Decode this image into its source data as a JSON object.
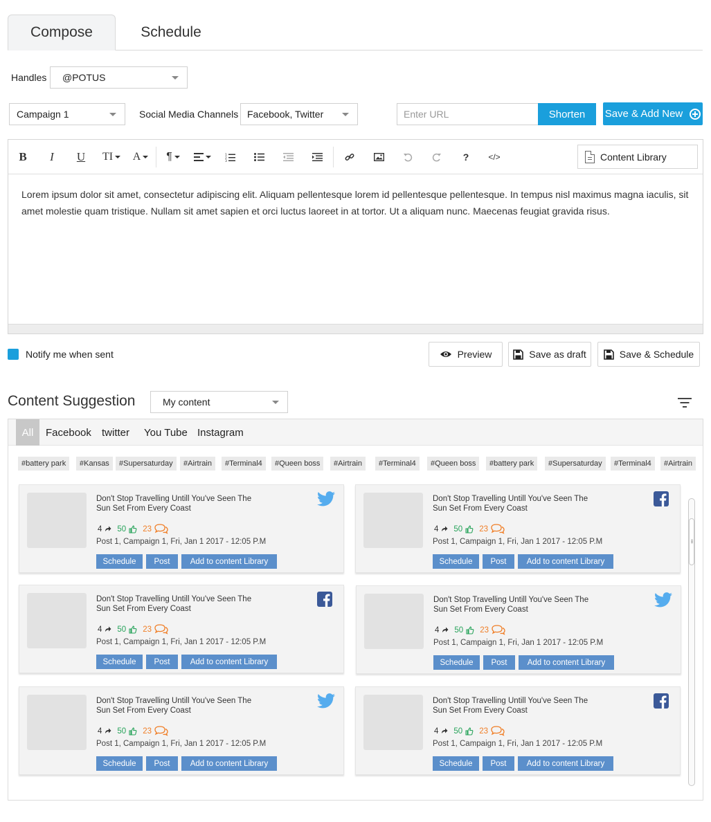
{
  "tabs": {
    "compose": "Compose",
    "schedule": "Schedule"
  },
  "handles": {
    "label": "Handles",
    "value": "@POTUS"
  },
  "campaign": {
    "value": "Campaign 1"
  },
  "channels": {
    "label": "Social Media Channels",
    "value": "Facebook, Twitter"
  },
  "url": {
    "placeholder": "Enter URL",
    "shorten": "Shorten"
  },
  "save_add_new": "Save & Add New",
  "editor": {
    "toolbar": {
      "bold": "B",
      "italic": "I",
      "underline": "U",
      "text_size": "TI",
      "font_color": "A",
      "paragraph": "¶",
      "help": "?",
      "code": "</>"
    },
    "content_library": "Content Library",
    "body": "Lorem ipsum dolor sit amet, consectetur adipiscing elit. Aliquam pellentesque lorem id pellentesque pellentesque. In tempus nisl maximus magna iaculis, sit amet molestie quam tristique. Nullam sit amet sapien et orci luctus laoreet in at tortor. Ut a aliquam nunc. Maecenas feugiat gravida risus."
  },
  "notify": {
    "label": "Notify me when sent",
    "checked": true
  },
  "actions": {
    "preview": "Preview",
    "save_draft": "Save as draft",
    "save_schedule": "Save & Schedule"
  },
  "suggestion": {
    "title": "Content Suggestion",
    "source": "My content",
    "filters": [
      "All",
      "Facebook",
      "twitter",
      "You Tube",
      "Instagram"
    ],
    "tags": [
      "#battery park",
      "#Kansas",
      "#Supersaturday",
      "#Airtrain",
      "#Terminal4",
      "#Queen boss",
      "#Airtrain",
      "#Terminal4",
      "#Queen boss",
      "#battery park",
      "#Supersaturday",
      "#Terminal4",
      "#Airtrain"
    ],
    "cards": [
      {
        "network": "twitter-icon",
        "title": "Don't Stop Travelling Untill You've Seen The Sun Set From Every Coast",
        "shares": "4",
        "likes": "50",
        "comments": "23",
        "meta": "Post 1, Campaign 1, Fri, Jan 1 2017 - 12:05 P.M",
        "schedule": "Schedule",
        "post": "Post",
        "add": "Add to content Library"
      },
      {
        "network": "facebook-icon",
        "title": "Don't Stop Travelling Untill You've Seen The Sun Set From Every Coast",
        "shares": "4",
        "likes": "50",
        "comments": "23",
        "meta": "Post 1, Campaign 1, Fri, Jan 1 2017 - 12:05 P.M",
        "schedule": "Schedule",
        "post": "Post",
        "add": "Add to content Library"
      },
      {
        "network": "facebook-icon",
        "title": "Don't Stop Travelling Untill You've Seen The Sun Set From Every Coast",
        "shares": "4",
        "likes": "50",
        "comments": "23",
        "meta": "Post 1, Campaign 1, Fri, Jan 1 2017 - 12:05 P.M",
        "schedule": "Schedule",
        "post": "Post",
        "add": "Add to content Library"
      },
      {
        "network": "twitter-icon",
        "title": "Don't Stop Travelling Untill You've Seen The Sun Set From Every Coast",
        "shares": "4",
        "likes": "50",
        "comments": "23",
        "meta": "Post 1, Campaign 1, Fri, Jan 1 2017 - 12:05 P.M",
        "schedule": "Schedule",
        "post": "Post",
        "add": "Add to content Library"
      },
      {
        "network": "twitter-icon",
        "title": "Don't Stop Travelling Untill You've Seen The Sun Set From Every Coast",
        "shares": "4",
        "likes": "50",
        "comments": "23",
        "meta": "Post 1, Campaign 1, Fri, Jan 1 2017 - 12:05 P.M",
        "schedule": "Schedule",
        "post": "Post",
        "add": "Add to content Library"
      },
      {
        "network": "facebook-icon",
        "title": "Don't Stop Travelling Untill You've Seen The Sun Set From Every Coast",
        "shares": "4",
        "likes": "50",
        "comments": "23",
        "meta": "Post 1, Campaign 1, Fri, Jan 1 2017 - 12:05 P.M",
        "schedule": "Schedule",
        "post": "Post",
        "add": "Add to content Library"
      }
    ]
  },
  "colors": {
    "accent": "#1a9fdc",
    "action_button": "#5b8fcb",
    "like": "#27a35a",
    "comment": "#f07e26",
    "twitter": "#55acee",
    "facebook": "#3b5998"
  }
}
